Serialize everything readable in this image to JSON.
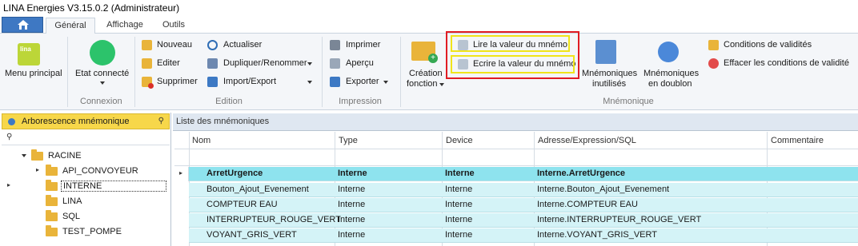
{
  "window": {
    "title": "LINA Energies  V3.15.0.2  (Administrateur)"
  },
  "tabs": [
    "Général",
    "Affichage",
    "Outils"
  ],
  "ribbon": {
    "menu_principal": "Menu principal",
    "connexion": {
      "etat_label": "Etat connecté",
      "group": "Connexion",
      "status_color": "#2cc36b"
    },
    "edition": {
      "nouveau": "Nouveau",
      "editer": "Editer",
      "supprimer": "Supprimer",
      "actualiser": "Actualiser",
      "dupliquer": "Dupliquer/Renommer",
      "import_export": "Import/Export",
      "group": "Edition"
    },
    "impression": {
      "imprimer": "Imprimer",
      "apercu": "Aperçu",
      "exporter": "Exporter",
      "group": "Impression"
    },
    "mnemonique": {
      "creation_1": "Création",
      "creation_2": "fonction",
      "lire": "Lire la valeur du mnémo",
      "ecrire": "Ecrire la valeur du mnémo",
      "inutilises_1": "Mnémoniques",
      "inutilises_2": "inutilisés",
      "doublon_1": "Mnémoniques",
      "doublon_2": "en doublon",
      "conditions": "Conditions de validités",
      "effacer": "Effacer les conditions de validité",
      "group": "Mnémonique"
    }
  },
  "tree": {
    "title": "Arborescence mnémonique",
    "root": "RACINE",
    "items": [
      "API_CONVOYEUR",
      "INTERNE",
      "LINA",
      "SQL",
      "TEST_POMPE"
    ]
  },
  "grid": {
    "title": "Liste des mnémoniques",
    "columns": [
      "Nom",
      "Type",
      "Device",
      "Adresse/Expression/SQL",
      "Commentaire"
    ],
    "rows": [
      {
        "nom": "ArretUrgence",
        "type": "Interne",
        "device": "Interne",
        "adresse": "Interne.ArretUrgence",
        "commentaire": ""
      },
      {
        "nom": "Bouton_Ajout_Evenement",
        "type": "Interne",
        "device": "Interne",
        "adresse": "Interne.Bouton_Ajout_Evenement",
        "commentaire": ""
      },
      {
        "nom": "COMPTEUR EAU",
        "type": "Interne",
        "device": "Interne",
        "adresse": "Interne.COMPTEUR EAU",
        "commentaire": ""
      },
      {
        "nom": "INTERRUPTEUR_ROUGE_VERT",
        "type": "Interne",
        "device": "Interne",
        "adresse": "Interne.INTERRUPTEUR_ROUGE_VERT",
        "commentaire": ""
      },
      {
        "nom": "VOYANT_GRIS_VERT",
        "type": "Interne",
        "device": "Interne",
        "adresse": "Interne.VOYANT_GRIS_VERT",
        "commentaire": ""
      }
    ]
  }
}
